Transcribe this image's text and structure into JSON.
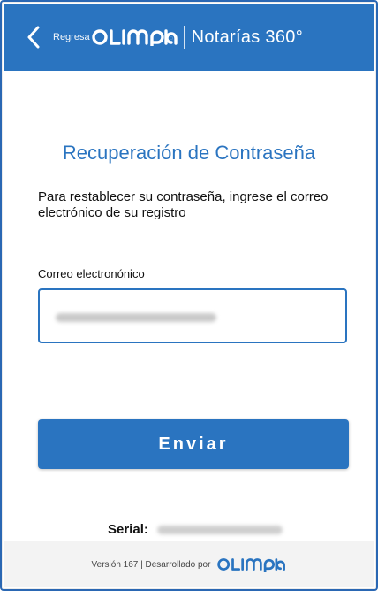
{
  "header": {
    "back_label": "Regresa",
    "brand": "OLIMPIA",
    "product": "Notarías 360°"
  },
  "main": {
    "title": "Recuperación de Contraseña",
    "description": "Para restablecer su contraseña, ingrese el correo electrónico de su registro",
    "email_label": "Correo electronónico",
    "email_value_note": "",
    "submit_label": "Enviar",
    "serial_label": "Serial:"
  },
  "footer": {
    "text": "Versión 167 | Desarrollado por",
    "brand": "OLIMPIA"
  },
  "colors": {
    "primary": "#2a74c0",
    "footer_bg": "#f3f3f3"
  },
  "icons": {
    "back": "chevron-left-icon"
  }
}
